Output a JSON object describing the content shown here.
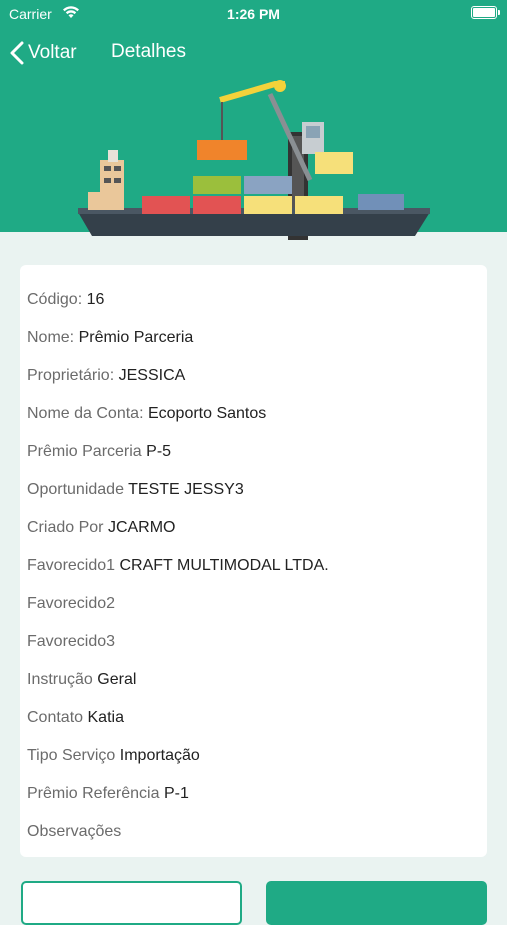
{
  "status_bar": {
    "carrier": "Carrier",
    "time": "1:26 PM"
  },
  "nav": {
    "back_label": "Voltar",
    "title": "Detalhes"
  },
  "colors": {
    "brand": "#1faa85",
    "background": "#eaf3f1"
  },
  "details": [
    {
      "label": "Código:",
      "value": "16"
    },
    {
      "label": "Nome:",
      "value": "Prêmio Parceria"
    },
    {
      "label": "Proprietário:",
      "value": "JESSICA"
    },
    {
      "label": "Nome da Conta:",
      "value": "Ecoporto Santos"
    },
    {
      "label": "Prêmio Parceria",
      "value": "P-5"
    },
    {
      "label": "Oportunidade",
      "value": "TESTE JESSY3"
    },
    {
      "label": "Criado Por",
      "value": "JCARMO"
    },
    {
      "label": "Favorecido1",
      "value": "CRAFT MULTIMODAL LTDA."
    },
    {
      "label": "Favorecido2",
      "value": ""
    },
    {
      "label": "Favorecido3",
      "value": ""
    },
    {
      "label": "Instrução",
      "value": "Geral"
    },
    {
      "label": "Contato",
      "value": "Katia"
    },
    {
      "label": "Tipo Serviço",
      "value": "Importação"
    },
    {
      "label": "Prêmio Referência",
      "value": "P-1"
    },
    {
      "label": "Observações",
      "value": ""
    }
  ]
}
